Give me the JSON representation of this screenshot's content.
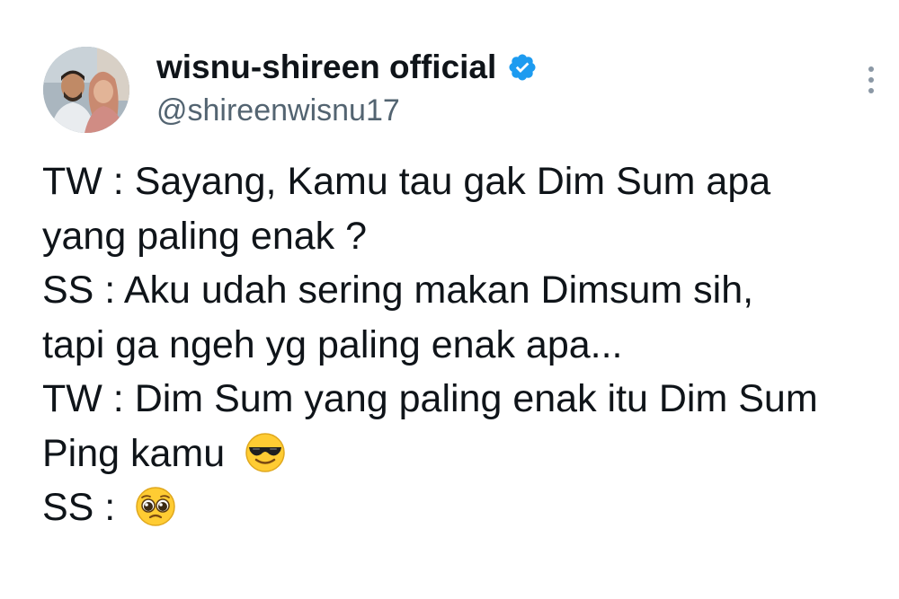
{
  "author": {
    "display_name": "wisnu-shireen official",
    "handle": "@shireenwisnu17",
    "verified": true,
    "verified_color": "#1d9bf0"
  },
  "tweet": {
    "lines": [
      "TW : Sayang, Kamu tau gak Dim Sum apa",
      "yang paling enak ?",
      "SS : Aku udah sering makan Dimsum sih,",
      "tapi ga ngeh yg paling enak apa...",
      "TW : Dim Sum yang paling enak itu Dim Sum",
      "Ping kamu",
      "SS :"
    ],
    "emojis": {
      "line_6": "smiling-face-with-sunglasses",
      "line_7": "pleading-face"
    }
  },
  "icons": {
    "more": "more-vertical-icon",
    "verified": "verified-badge-icon"
  },
  "colors": {
    "text_primary": "#0f1419",
    "text_secondary": "#536471"
  }
}
